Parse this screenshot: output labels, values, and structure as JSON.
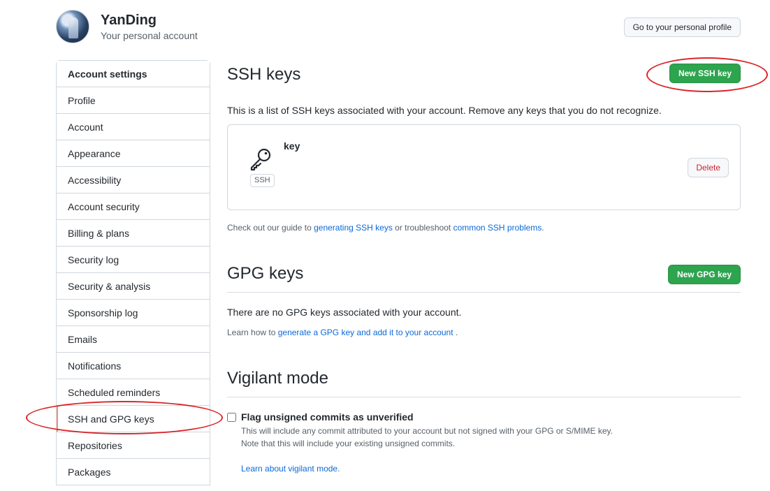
{
  "header": {
    "user_name": "YanDing",
    "user_subtitle": "Your personal account",
    "profile_button": "Go to your personal profile"
  },
  "sidebar": {
    "heading": "Account settings",
    "selected_index": 12,
    "items": [
      {
        "label": "Profile"
      },
      {
        "label": "Account"
      },
      {
        "label": "Appearance"
      },
      {
        "label": "Accessibility"
      },
      {
        "label": "Account security"
      },
      {
        "label": "Billing & plans"
      },
      {
        "label": "Security log"
      },
      {
        "label": "Security & analysis"
      },
      {
        "label": "Sponsorship log"
      },
      {
        "label": "Emails"
      },
      {
        "label": "Notifications"
      },
      {
        "label": "Scheduled reminders"
      },
      {
        "label": "SSH and GPG keys"
      },
      {
        "label": "Repositories"
      },
      {
        "label": "Packages"
      }
    ]
  },
  "ssh": {
    "title": "SSH keys",
    "new_button": "New SSH key",
    "description": "This is a list of SSH keys associated with your account. Remove any keys that you do not recognize.",
    "key": {
      "title": "key",
      "badge": "SSH",
      "delete_button": "Delete"
    },
    "guide_prefix": "Check out our guide to",
    "guide_link1": "generating SSH keys",
    "guide_middle": "or troubleshoot",
    "guide_link2": "common SSH problems",
    "guide_suffix": "."
  },
  "gpg": {
    "title": "GPG keys",
    "new_button": "New GPG key",
    "empty_text": "There are no GPG keys associated with your account.",
    "learn_prefix": "Learn how to",
    "learn_link": "generate a GPG key and add it to your account",
    "learn_suffix": "."
  },
  "vigilant": {
    "title": "Vigilant mode",
    "checkbox_label": "Flag unsigned commits as unverified",
    "checked": false,
    "note_line1": "This will include any commit attributed to your account but not signed with your GPG or S/MIME key.",
    "note_line2": "Note that this will include your existing unsigned commits.",
    "learn_link": "Learn about vigilant mode",
    "learn_suffix": "."
  },
  "colors": {
    "primary_button": "#2da44e",
    "link": "#0969da",
    "danger": "#cf222e",
    "annotation": "#d9262a",
    "selected_marker": "#fd8c73"
  },
  "icons": {
    "ssh_key": "key-icon"
  }
}
